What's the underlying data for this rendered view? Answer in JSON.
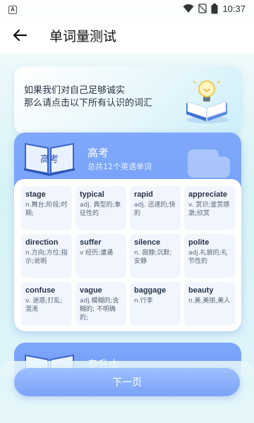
{
  "status_bar": {
    "time": "10:37",
    "app_badge": "A"
  },
  "header": {
    "title": "单词量测试"
  },
  "intro": {
    "line1": "如果我们对自己足够诚实",
    "line2": "那么请点击以下所有认识的词汇"
  },
  "level": {
    "name": "高考",
    "subtitle": "总共12个英语单词",
    "book_label": "高考",
    "words": [
      {
        "en": "stage",
        "cn": "n.舞台;阶段;时期;"
      },
      {
        "en": "typical",
        "cn": "adj. 典型的;象征性的"
      },
      {
        "en": "rapid",
        "cn": "adj. 迅速的;快的"
      },
      {
        "en": "appreciate",
        "cn": "v. 赏识;鉴赏感激;欣赏"
      },
      {
        "en": "direction",
        "cn": "n.方向;方位;指示;说明"
      },
      {
        "en": "suffer",
        "cn": "v 经历;遭遇"
      },
      {
        "en": "silence",
        "cn": "n. 寂静;沉默;安静"
      },
      {
        "en": "polite",
        "cn": "adj.礼貌的;礼节性的"
      },
      {
        "en": "confuse",
        "cn": "v. 迷惑;打乱;混淆"
      },
      {
        "en": "vague",
        "cn": "adj.模糊的;含糊的; 不明确的;"
      },
      {
        "en": "baggage",
        "cn": "n.行李"
      },
      {
        "en": "beauty",
        "cn": "n.美,美丽,美人"
      }
    ]
  },
  "level2": {
    "name": "专升本"
  },
  "footer": {
    "next_label": "下一页"
  }
}
